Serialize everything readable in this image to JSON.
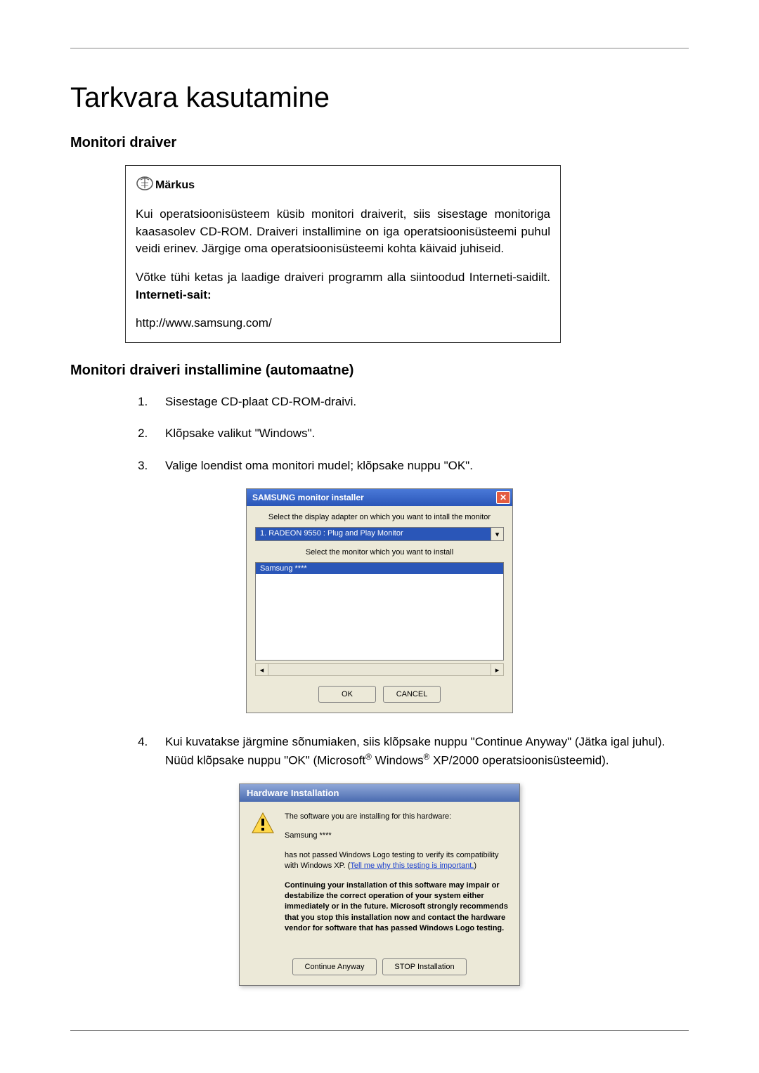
{
  "title": "Tarkvara kasutamine",
  "section1": "Monitori draiver",
  "note": {
    "label": "Märkus",
    "p1": "Kui operatsioonisüsteem küsib monitori draiverit, siis sisestage monitoriga kaasasolev CD-ROM. Draiveri installimine on iga operatsioonisüsteemi puhul veidi erinev. Järgige oma operatsioonisüsteemi kohta käivaid juhiseid.",
    "p2a": "Võtke tühi ketas ja laadige draiveri programm alla siintoodud Interneti-saidilt. ",
    "p2b": "Interneti-sait:",
    "url": "http://www.samsung.com/"
  },
  "section2": "Monitori draiveri installimine (automaatne)",
  "steps": {
    "s1": "Sisestage CD-plaat CD-ROM-draivi.",
    "s2": "Klõpsake valikut \"Windows\".",
    "s3": "Valige loendist oma monitori mudel; klõpsake nuppu \"OK\".",
    "s4_a": "Kui kuvatakse järgmine sõnumiaken, siis klõpsake nuppu \"Continue Anyway\" (Jätka igal juhul). Nüüd klõpsake nuppu \"OK\" (Microsoft",
    "s4_b": " Windows",
    "s4_c": " XP/2000 operatsioonisüsteemid)."
  },
  "installer": {
    "title": "SAMSUNG monitor installer",
    "prompt1": "Select the display adapter on which you want to intall the monitor",
    "adapter": "1. RADEON 9550 : Plug and Play Monitor",
    "prompt2": "Select the monitor which you want to install",
    "model": "Samsung ****",
    "ok": "OK",
    "cancel": "CANCEL"
  },
  "hwdlg": {
    "title": "Hardware Installation",
    "p1": "The software you are installing for this hardware:",
    "hwname": "Samsung ****",
    "p2a": "has not passed Windows Logo testing to verify its compatibility with Windows XP. (",
    "link": "Tell me why this testing is important.",
    "p2b": ")",
    "warn": "Continuing your installation of this software may impair or destabilize the correct operation of your system either immediately or in the future. Microsoft strongly recommends that you stop this installation now and contact the hardware vendor for software that has passed Windows Logo testing.",
    "btn_continue": "Continue Anyway",
    "btn_stop": "STOP Installation"
  }
}
